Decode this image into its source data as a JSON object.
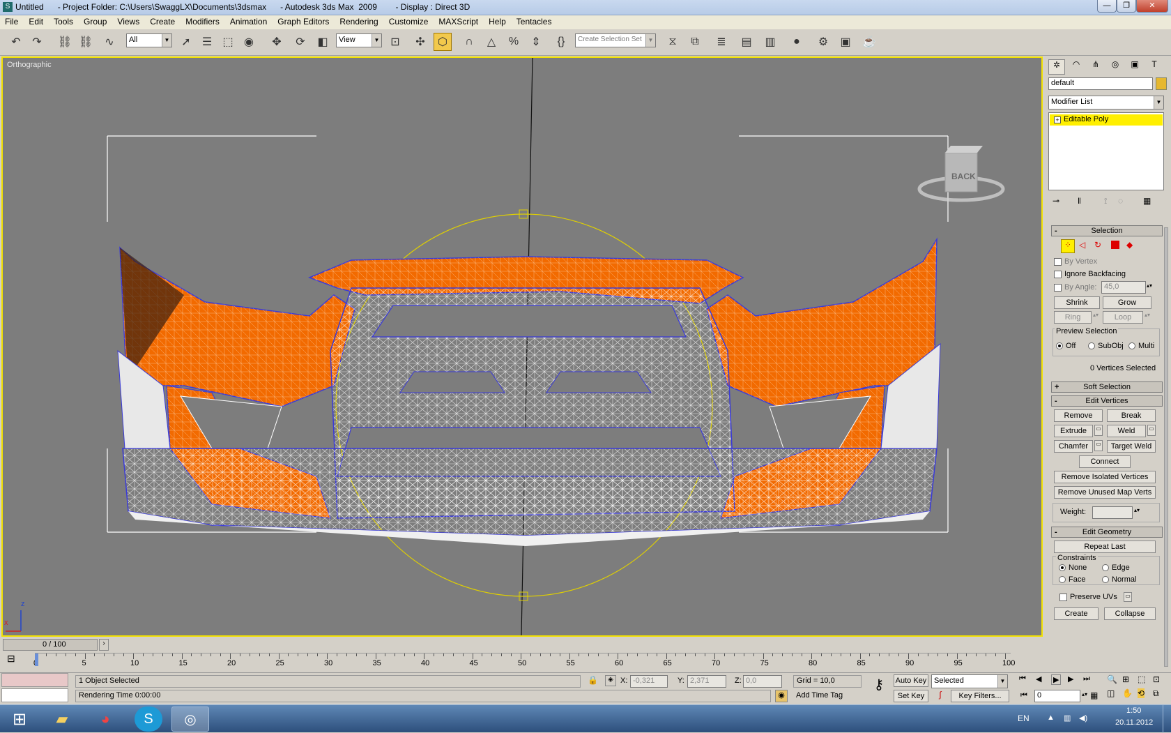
{
  "window": {
    "title": "Untitled      - Project Folder: C:\\Users\\SwaggLX\\Documents\\3dsmax      - Autodesk 3ds Max  2009        - Display : Direct 3D",
    "controls": {
      "minimize": "—",
      "maximize": "❐",
      "close": "✕"
    }
  },
  "menu": [
    "File",
    "Edit",
    "Tools",
    "Group",
    "Views",
    "Create",
    "Modifiers",
    "Animation",
    "Graph Editors",
    "Rendering",
    "Customize",
    "MAXScript",
    "Help",
    "Tentacles"
  ],
  "toolbar": {
    "selection_filter": "All",
    "ref_coord": "View",
    "named_selection": "Create Selection Set"
  },
  "viewport": {
    "label": "Orthographic",
    "viewcube_label": "BACK",
    "axis_x": "x",
    "axis_z": "z"
  },
  "command_panel": {
    "object_name": "default",
    "modifier_list": "Modifier List",
    "stack_item": "Editable Poly",
    "selection": {
      "header": "Selection",
      "by_vertex": "By Vertex",
      "ignore_backfacing": "Ignore Backfacing",
      "by_angle": "By Angle:",
      "angle_value": "45,0",
      "shrink": "Shrink",
      "grow": "Grow",
      "ring": "Ring",
      "loop": "Loop",
      "preview_selection": "Preview Selection",
      "preview_off": "Off",
      "preview_subobj": "SubObj",
      "preview_multi": "Multi",
      "status": "0 Vertices Selected"
    },
    "soft_selection": "Soft Selection",
    "edit_vertices": {
      "header": "Edit Vertices",
      "remove": "Remove",
      "break": "Break",
      "extrude": "Extrude",
      "weld": "Weld",
      "chamfer": "Chamfer",
      "target_weld": "Target Weld",
      "connect": "Connect",
      "remove_isolated": "Remove Isolated Vertices",
      "remove_unused": "Remove Unused Map Verts",
      "weight_label": "Weight:"
    },
    "edit_geometry": {
      "header": "Edit Geometry",
      "repeat_last": "Repeat Last",
      "constraints": "Constraints",
      "none": "None",
      "edge": "Edge",
      "face": "Face",
      "normal": "Normal",
      "preserve_uvs": "Preserve UVs",
      "create": "Create",
      "collapse": "Collapse"
    }
  },
  "timeline": {
    "frame_counter": "0 / 100",
    "ticks": [
      "0",
      "5",
      "10",
      "15",
      "20",
      "25",
      "30",
      "35",
      "40",
      "45",
      "50",
      "55",
      "60",
      "65",
      "70",
      "75",
      "80",
      "85",
      "90",
      "95",
      "100"
    ]
  },
  "status": {
    "selection_info": "1 Object Selected",
    "render_time": "Rendering Time  0:00:00",
    "x_label": "X:",
    "x_value": "-0,321",
    "y_label": "Y:",
    "y_value": "2,371",
    "z_label": "Z:",
    "z_value": "0,0",
    "grid": "Grid = 10,0",
    "add_time_tag": "Add Time Tag",
    "auto_key": "Auto Key",
    "set_key": "Set Key",
    "key_mode": "Selected",
    "key_filters": "Key Filters...",
    "current_frame": "0"
  },
  "taskbar": {
    "lang": "EN",
    "time": "1:50",
    "date": "20.11.2012"
  }
}
